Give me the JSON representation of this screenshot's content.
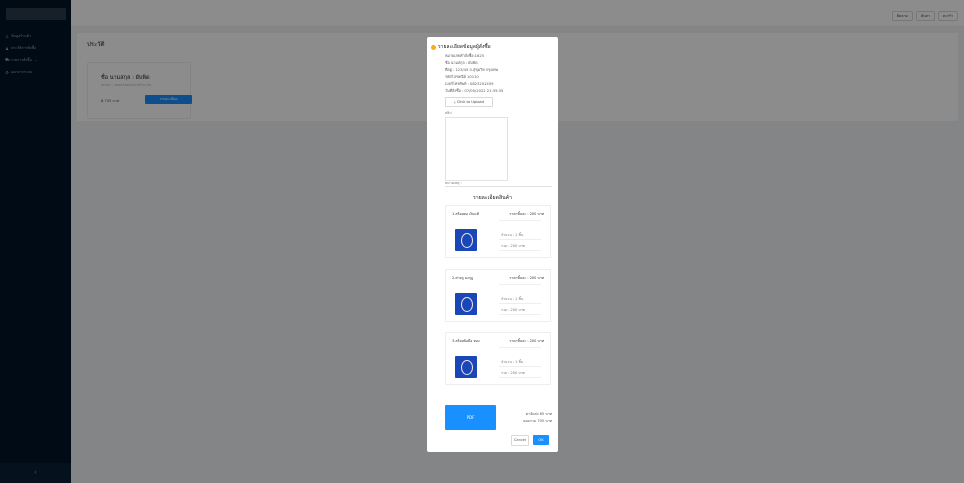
{
  "sidebar": {
    "items": [
      {
        "icon": "user-icon",
        "label": "ข้อมูลร้านค้า",
        "has_caret": false
      },
      {
        "icon": "user-group-icon",
        "label": "ประวัติการสั่งซื้อ",
        "has_caret": false
      },
      {
        "icon": "cart-icon",
        "label": "รายการสั่งซื้อ",
        "has_caret": true
      },
      {
        "icon": "gear-icon",
        "label": "ออกจากระบบ",
        "has_caret": false
      }
    ],
    "collapse_label": "‹"
  },
  "header": {
    "buttons": [
      "ติดตาม",
      "ค้นหา",
      "ตะกร้า"
    ]
  },
  "page": {
    "title": "ประวัติ",
    "shop_card": {
      "name": "ชื่อ นามสกุล : ผับพิด",
      "desc": "สถานะ : รอตรวจสอบการชำระเงิน",
      "price": "฿ 705 บาท",
      "detail_button": "รายละเอียด"
    }
  },
  "modal": {
    "title": "รายละเอียดข้อมูลผู้สั่งซื้อ",
    "info": [
      "หมายเลขคำสั่งซื้อ:1625",
      "ชื่อ นามสกุล : ผับพิด",
      "ที่อยู่ : 123/45 ถ.สุขุมวิท กรุงเทพ",
      "รหัสไปรษณีย์ 10110",
      "เบอร์โทรศัพท์ : 0823201459",
      "วันที่สั่งซื้อ : 07/05/2022 21:35:35"
    ],
    "upload_label": "⤓ Click to Upload",
    "slip_label": "สลิป",
    "note_label": "หมายเหตุ :",
    "products_title": "รายละเอียดสินค้า",
    "products": [
      {
        "name": "1.สร้อยคอ เงินแท้",
        "unit_price": "ราคาชิ้นละ : 200 บาท",
        "qty": "จำนวน : 1 ชิ้น",
        "total": "รวม : 200 บาท"
      },
      {
        "name": "2.ต่างหู มงกุฎ",
        "unit_price": "ราคาชิ้นละ : 200 บาท",
        "qty": "จำนวน : 1 ชิ้น",
        "total": "รวม : 200 บาท"
      },
      {
        "name": "3.สร้อยข้อมือ ทอง",
        "unit_price": "ราคาชิ้นละ : 200 บาท",
        "qty": "จำนวน : 1 ชิ้น",
        "total": "รวม : 200 บาท"
      }
    ],
    "pdf_label": "PDF",
    "shipping_text": "ค่าจัดส่ง 65 บาท",
    "total_text": "ยอดรวม 705 บาท",
    "cancel_label": "Cancel",
    "ok_label": "OK"
  },
  "colors": {
    "sidebar_bg": "#001529",
    "primary": "#1890ff",
    "warning": "#faad14"
  }
}
